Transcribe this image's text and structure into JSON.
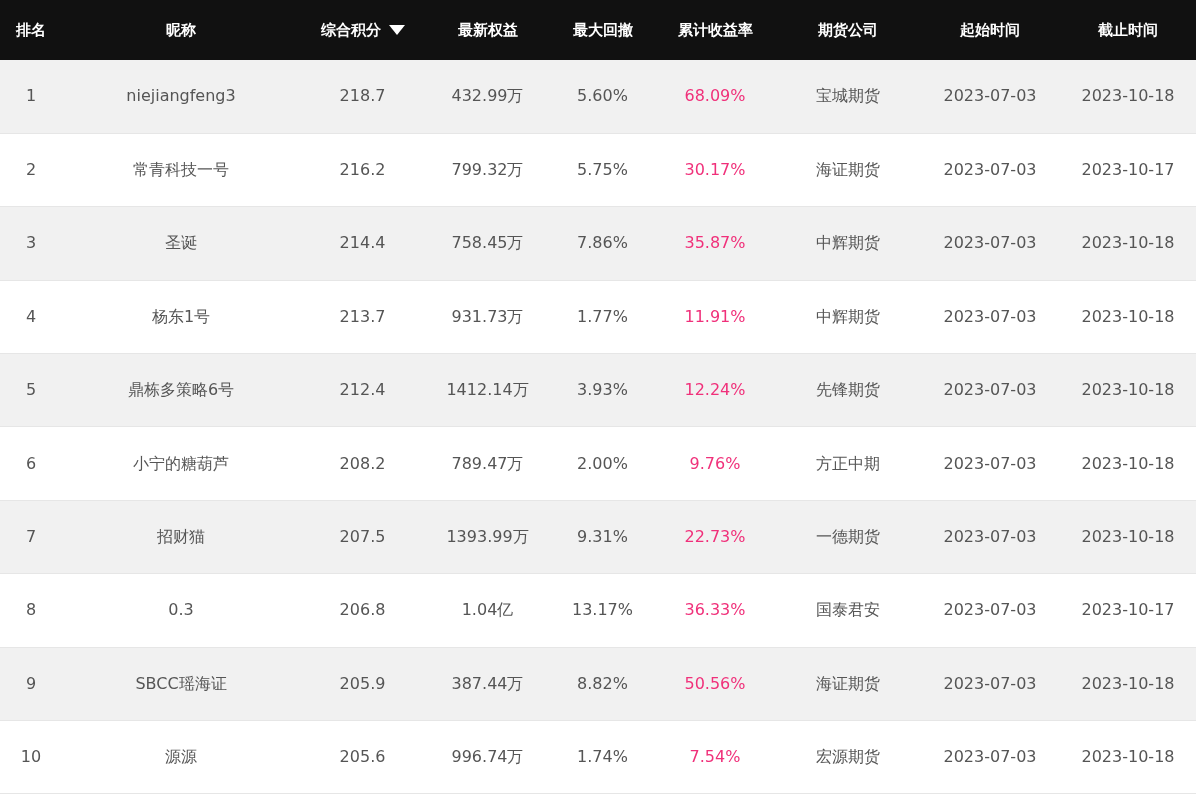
{
  "table": {
    "columns": [
      {
        "label": "排名",
        "kind": "text",
        "sorted": false
      },
      {
        "label": "昵称",
        "kind": "text",
        "sorted": false
      },
      {
        "label": "综合积分",
        "kind": "text",
        "sorted": true
      },
      {
        "label": "最新权益",
        "kind": "text",
        "sorted": false
      },
      {
        "label": "最大回撤",
        "kind": "text",
        "sorted": false
      },
      {
        "label": "累计收益率",
        "kind": "return",
        "sorted": false
      },
      {
        "label": "期货公司",
        "kind": "text",
        "sorted": false
      },
      {
        "label": "起始时间",
        "kind": "text",
        "sorted": false
      },
      {
        "label": "截止时间",
        "kind": "text",
        "sorted": false
      }
    ],
    "rows": [
      [
        "1",
        "niejiangfeng3",
        "218.7",
        "432.99万",
        "5.60%",
        "68.09%",
        "宝城期货",
        "2023-07-03",
        "2023-10-18"
      ],
      [
        "2",
        "常青科技一号",
        "216.2",
        "799.32万",
        "5.75%",
        "30.17%",
        "海证期货",
        "2023-07-03",
        "2023-10-17"
      ],
      [
        "3",
        "圣诞",
        "214.4",
        "758.45万",
        "7.86%",
        "35.87%",
        "中辉期货",
        "2023-07-03",
        "2023-10-18"
      ],
      [
        "4",
        "杨东1号",
        "213.7",
        "931.73万",
        "1.77%",
        "11.91%",
        "中辉期货",
        "2023-07-03",
        "2023-10-18"
      ],
      [
        "5",
        "鼎栋多策略6号",
        "212.4",
        "1412.14万",
        "3.93%",
        "12.24%",
        "先锋期货",
        "2023-07-03",
        "2023-10-18"
      ],
      [
        "6",
        "小宁的糖葫芦",
        "208.2",
        "789.47万",
        "2.00%",
        "9.76%",
        "方正中期",
        "2023-07-03",
        "2023-10-18"
      ],
      [
        "7",
        "招财猫",
        "207.5",
        "1393.99万",
        "9.31%",
        "22.73%",
        "一德期货",
        "2023-07-03",
        "2023-10-18"
      ],
      [
        "8",
        "0.3",
        "206.8",
        "1.04亿",
        "13.17%",
        "36.33%",
        "国泰君安",
        "2023-07-03",
        "2023-10-17"
      ],
      [
        "9",
        "SBCC瑶海证",
        "205.9",
        "387.44万",
        "8.82%",
        "50.56%",
        "海证期货",
        "2023-07-03",
        "2023-10-18"
      ],
      [
        "10",
        "源源",
        "205.6",
        "996.74万",
        "1.74%",
        "7.54%",
        "宏源期货",
        "2023-07-03",
        "2023-10-18"
      ]
    ]
  }
}
